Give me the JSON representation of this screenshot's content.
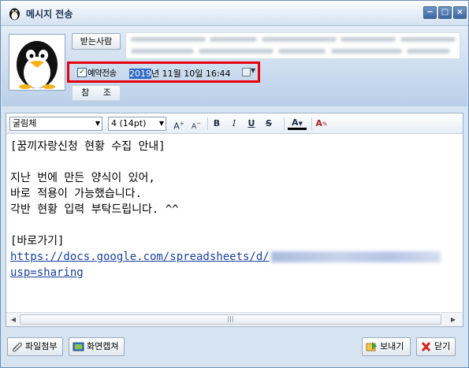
{
  "window": {
    "title": "메시지 전송",
    "controls": {
      "minimize": "−",
      "maximize": "□",
      "close": "×"
    }
  },
  "header": {
    "recipients_button": "받는사람",
    "recipients_value": "(blurred recipient list)",
    "reference_button": "참 조",
    "scheduled": {
      "checked": true,
      "label": "예약전송",
      "date_selected": "2019",
      "date_rest": "년 11월 10일 16:44"
    },
    "highlight_color": "#e5000c"
  },
  "toolbar": {
    "font_family": "굴림체",
    "font_size": "4 (14pt)",
    "font_grow": "A",
    "font_shrink": "A",
    "bold": "B",
    "italic": "I",
    "underline": "U",
    "strike": "S",
    "text_color": "A",
    "highlight": "A"
  },
  "message": {
    "line1": "[꿈끼자랑신청 현황 수집 안내]",
    "line2": "",
    "line3": "지난 번에 만든 양식이 있어,",
    "line4": "바로 적용이 가능했습니다.",
    "line5": "각반 현황 입력 부탁드립니다. ^^",
    "line6": "",
    "line7": "[바로가기]",
    "link_prefix": "https://docs.google.com/spreadsheets/d/",
    "link_suffix": "usp=sharing"
  },
  "footer": {
    "attach_button": "파일첨부",
    "capture_button": "화면캡쳐",
    "send_button": "보내기",
    "close_button": "닫기"
  },
  "colors": {
    "accent": "#316ac5",
    "link": "#1a3f9c",
    "header_gradient_top": "#e4edf7",
    "header_gradient_bottom": "#b9cfe8"
  }
}
